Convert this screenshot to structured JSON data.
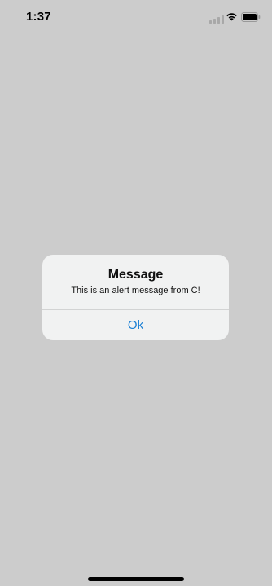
{
  "status_bar": {
    "time": "1:37",
    "icons": [
      "cellular-signal-icon",
      "wifi-icon",
      "battery-icon"
    ]
  },
  "alert": {
    "title": "Message",
    "message": "This is an alert message from C!",
    "ok_label": "Ok"
  },
  "colors": {
    "background": "#cccccc",
    "dialog_background": "#f1f2f2",
    "button_text": "#1a7fd4"
  }
}
